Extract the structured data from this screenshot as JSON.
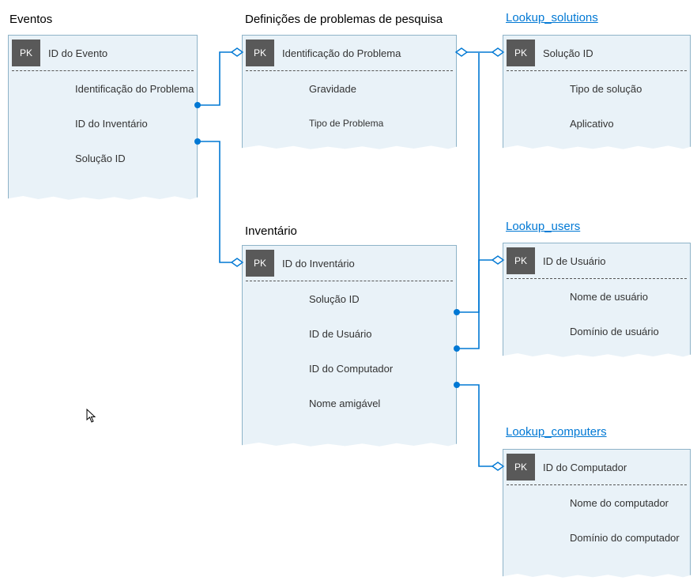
{
  "tables": {
    "eventos": {
      "title": "Eventos",
      "fields": [
        "ID do Evento",
        "Identificação do Problema",
        "ID do Inventário",
        "Solução   ID"
      ]
    },
    "defs": {
      "title": "Definições de problemas de pesquisa",
      "fields": [
        "Identificação do Problema",
        "Gravidade",
        "Tipo de Problema"
      ]
    },
    "solutions": {
      "title": "Lookup_solutions",
      "fields": [
        "Solução   ID",
        "Tipo de solução",
        "Aplicativo"
      ]
    },
    "inventario": {
      "title": "Inventário",
      "fields": [
        "ID do Inventário",
        "Solução   ID",
        "ID de Usuário",
        "ID do Computador",
        "Nome amigável"
      ]
    },
    "users": {
      "title": "Lookup_users",
      "fields": [
        "ID de Usuário",
        "Nome de usuário",
        "Domínio de usuário"
      ]
    },
    "computers": {
      "title": "Lookup_computers",
      "fields": [
        "ID do Computador",
        "Nome do computador",
        "Domínio do computador"
      ]
    }
  },
  "pk_label": "PK"
}
